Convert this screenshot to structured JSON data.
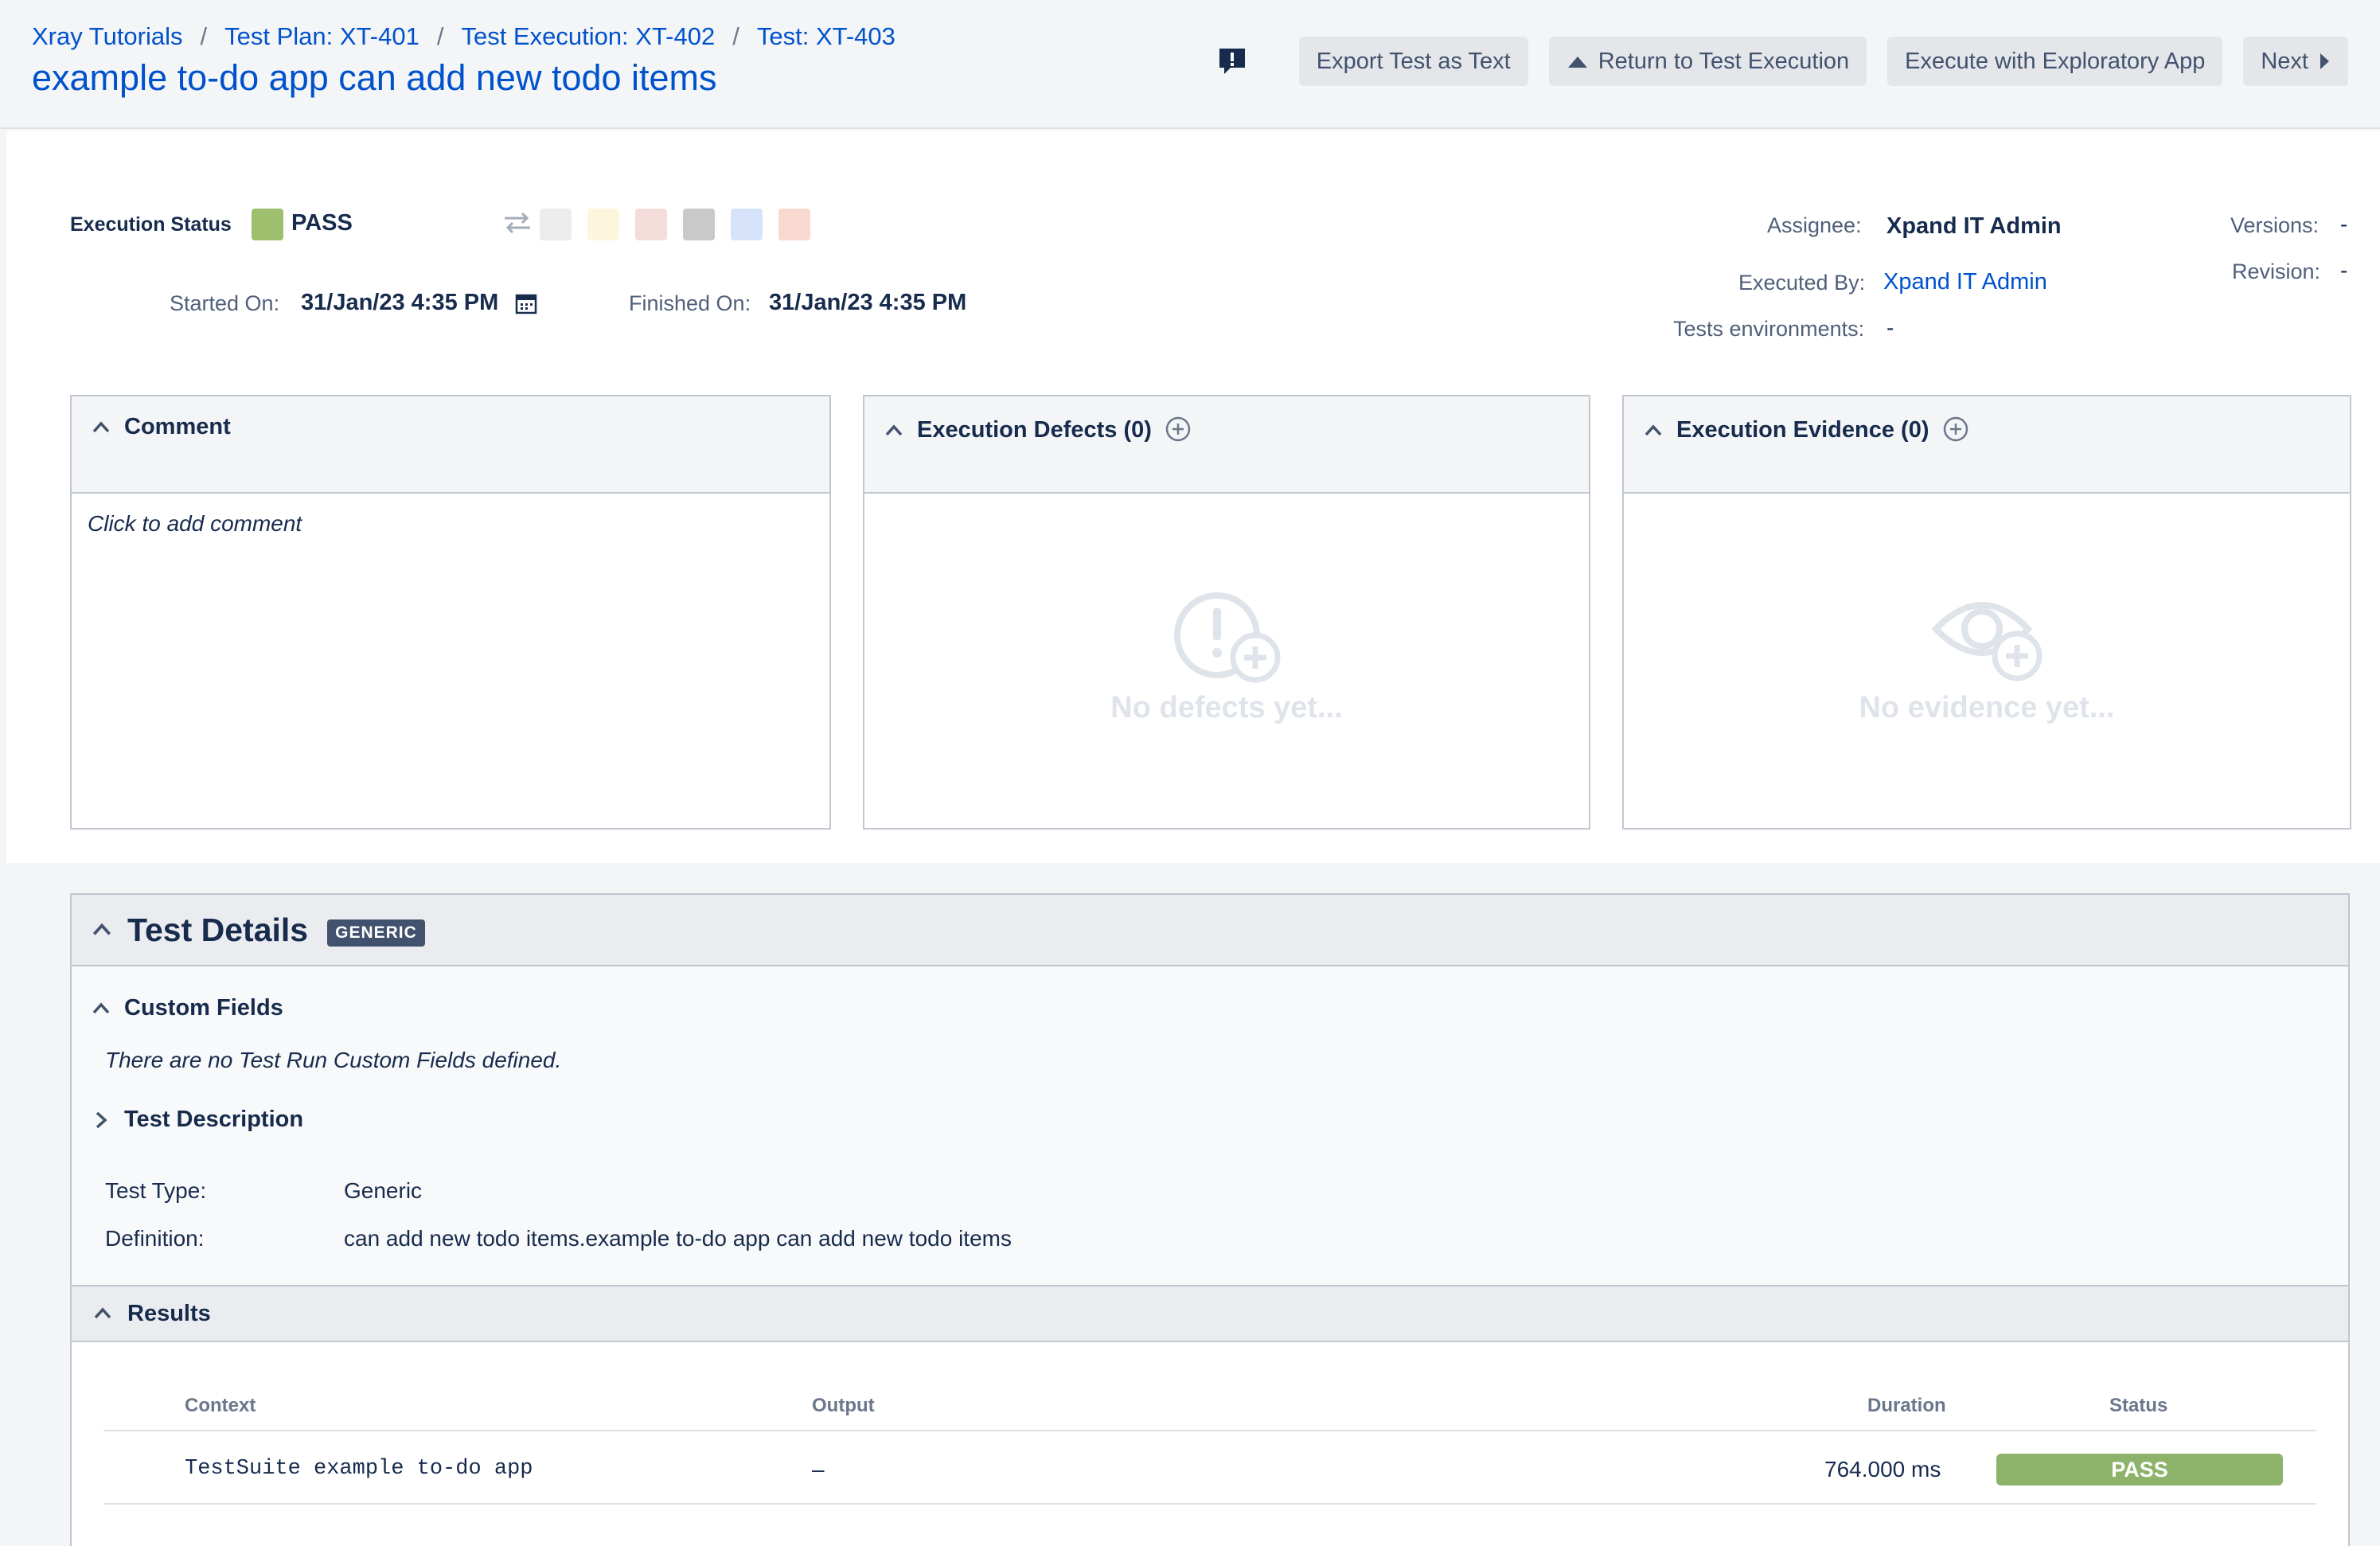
{
  "breadcrumb": [
    {
      "label": "Xray Tutorials"
    },
    {
      "label": "Test Plan: XT-401"
    },
    {
      "label": "Test Execution: XT-402"
    },
    {
      "label": "Test: XT-403"
    }
  ],
  "breadcrumb_separator": "/",
  "title": "example to-do app can add new todo items",
  "toolbar": {
    "export_label": "Export Test as Text",
    "return_label": "Return to Test Execution",
    "exploratory_label": "Execute with Exploratory App",
    "next_label": "Next"
  },
  "execution": {
    "status_label": "Execution Status",
    "status_value": "PASS",
    "status_color": "#9ebf6d",
    "other_status_colors": [
      "#ececec",
      "#fdf6dc",
      "#f3dcd9",
      "#c9c9c9",
      "#d6e3fb",
      "#f9d8cf"
    ],
    "started_label": "Started On:",
    "started_value": "31/Jan/23 4:35 PM",
    "finished_label": "Finished On:",
    "finished_value": "31/Jan/23 4:35 PM",
    "assignee_label": "Assignee:",
    "assignee_value": "Xpand IT Admin",
    "executed_by_label": "Executed By:",
    "executed_by_value": "Xpand IT Admin",
    "env_label": "Tests environments:",
    "env_value": "-",
    "versions_label": "Versions:",
    "versions_value": "-",
    "revision_label": "Revision:",
    "revision_value": "-"
  },
  "panels": {
    "comment_title": "Comment",
    "comment_placeholder": "Click to add comment",
    "defects_title": "Execution Defects (0)",
    "defects_empty": "No defects yet...",
    "evidence_title": "Execution Evidence (0)",
    "evidence_empty": "No evidence yet..."
  },
  "details": {
    "title": "Test Details",
    "badge": "GENERIC",
    "custom_fields_title": "Custom Fields",
    "custom_fields_empty": "There are no Test Run Custom Fields defined.",
    "description_title": "Test Description",
    "test_type_label": "Test Type:",
    "test_type_value": "Generic",
    "definition_label": "Definition:",
    "definition_value": "can add new todo items.example to-do app can add new todo items"
  },
  "results": {
    "title": "Results",
    "columns": {
      "context": "Context",
      "output": "Output",
      "duration": "Duration",
      "status": "Status"
    },
    "rows": [
      {
        "context": "TestSuite example to-do app",
        "output": "–",
        "duration": "764.000 ms",
        "status": "PASS"
      }
    ]
  }
}
